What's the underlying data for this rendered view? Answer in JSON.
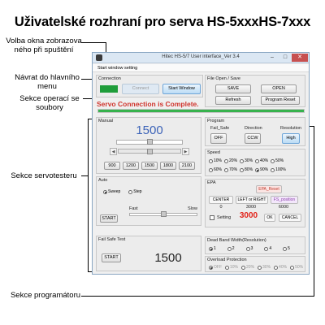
{
  "page": {
    "title": "Uživatelské rozhraní pro serva HS-5xxxHS-7xxx"
  },
  "annotations": {
    "start_window_choice": "Volba okna zobrazova\nného při spuštění",
    "back_to_main_menu": "Návrat do hlavního\nmenu",
    "file_operations_section": "Sekce operací se\nsoubory",
    "servo_tester_section": "Sekce servotesteru",
    "programmer_section": "Sekce programátoru"
  },
  "window": {
    "title": "Hitec HS-5/7 User interface_Ver 3.4",
    "controls": {
      "minimize": "–",
      "maximize": "□",
      "close": "✕"
    },
    "menu": "Start window setting"
  },
  "connection": {
    "label": "Connection",
    "connect_label": "Connect",
    "start_window_label": "Start Window",
    "status_text": "Servo Connection is Complete.",
    "progress": 1.0,
    "indicator_color": "#1f9d3a"
  },
  "file": {
    "label": "File Open / Save",
    "save_label": "SAVE",
    "open_label": "OPEN",
    "refresh_label": "Refresh",
    "program_reset_label": "Program Reset"
  },
  "manual": {
    "label": "Manual",
    "value": "1500",
    "slider_position": 0.5,
    "presets": [
      "900",
      "1200",
      "1500",
      "1800",
      "2100"
    ]
  },
  "auto": {
    "label": "Auto",
    "modes": [
      {
        "label": "Sweep",
        "selected": true
      },
      {
        "label": "Step",
        "selected": false
      }
    ],
    "fast_label": "Fast",
    "slow_label": "Slow",
    "start_label": "START",
    "speed_position": 0.5
  },
  "fail_safe_test": {
    "label": "Fail Safe Test",
    "start_label": "START",
    "value": "1500"
  },
  "program": {
    "label": "Program",
    "fail_safe_label": "Fail_Safe",
    "fail_safe_value": "OFF",
    "direction_label": "Direction",
    "direction_value": "CCW",
    "resolution_label": "Resolution",
    "resolution_value": "High"
  },
  "speed": {
    "label": "Speed",
    "options": [
      {
        "label": "10%",
        "selected": false
      },
      {
        "label": "20%",
        "selected": false
      },
      {
        "label": "30%",
        "selected": false
      },
      {
        "label": "40%",
        "selected": false
      },
      {
        "label": "50%",
        "selected": false
      },
      {
        "label": "60%",
        "selected": false
      },
      {
        "label": "70%",
        "selected": false
      },
      {
        "label": "80%",
        "selected": false
      },
      {
        "label": "90%",
        "selected": true
      },
      {
        "label": "100%",
        "selected": false
      }
    ]
  },
  "epa": {
    "label": "EPA",
    "reset_label": "EPA_Reset",
    "center_label": "CENTER",
    "left_right_label": "LEFT or RIGHT",
    "fs_position_label": "FS_position",
    "left_value": "0",
    "center_value": "3000",
    "right_value": "6000",
    "setting_label": "Setting",
    "setting_value": "3000",
    "ok_label": "OK",
    "cancel_label": "CANCEL"
  },
  "dead_band": {
    "label": "Dead Band Width(Resolution)",
    "options": [
      {
        "label": "1",
        "selected": true
      },
      {
        "label": "2",
        "selected": false
      },
      {
        "label": "3",
        "selected": false
      },
      {
        "label": "4",
        "selected": false
      },
      {
        "label": "5",
        "selected": false
      }
    ]
  },
  "overload": {
    "label": "Overload Protection",
    "options": [
      {
        "label": "OFF",
        "selected": true
      },
      {
        "label": "10%",
        "selected": false
      },
      {
        "label": "20%",
        "selected": false
      },
      {
        "label": "30%",
        "selected": false
      },
      {
        "label": "40%",
        "selected": false
      },
      {
        "label": "50%",
        "selected": false
      }
    ]
  }
}
